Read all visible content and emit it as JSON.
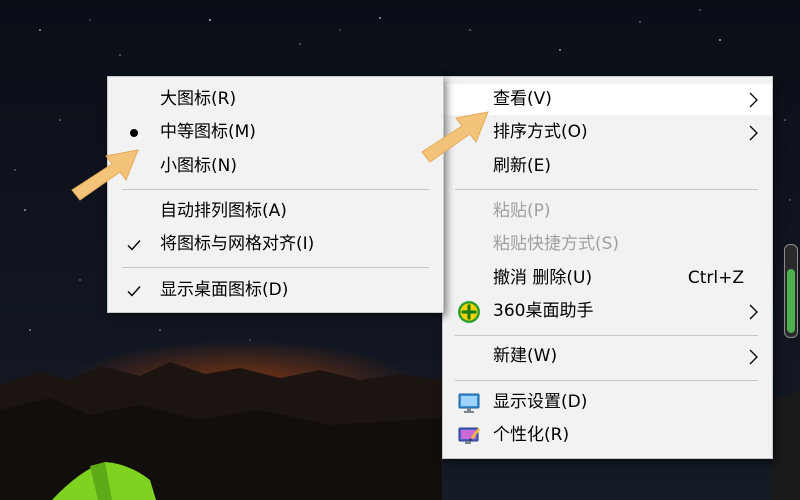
{
  "context_menu": {
    "items": [
      {
        "label": "查看(V)"
      },
      {
        "label": "排序方式(O)"
      },
      {
        "label": "刷新(E)"
      },
      {
        "label": "粘贴(P)"
      },
      {
        "label": "粘贴快捷方式(S)"
      },
      {
        "label": "撤消 删除(U)",
        "shortcut": "Ctrl+Z"
      },
      {
        "label": "360桌面助手",
        "icon": "360-plus-icon"
      },
      {
        "label": "新建(W)"
      },
      {
        "label": "显示设置(D)",
        "icon": "display-icon"
      },
      {
        "label": "个性化(R)",
        "icon": "personalize-icon"
      }
    ]
  },
  "view_submenu": {
    "items": [
      {
        "label": "大图标(R)"
      },
      {
        "label": "中等图标(M)",
        "mark": "bullet"
      },
      {
        "label": "小图标(N)"
      },
      {
        "label": "自动排列图标(A)"
      },
      {
        "label": "将图标与网格对齐(I)",
        "mark": "check"
      },
      {
        "label": "显示桌面图标(D)",
        "mark": "check"
      }
    ]
  },
  "colors": {
    "menu_bg": "#f2f2f2",
    "highlight": "#ffffff",
    "disabled_text": "#a0a0a0",
    "arrow": "#f4c37a",
    "scroll_accent": "#4caf50",
    "tent": "#7ed321"
  }
}
